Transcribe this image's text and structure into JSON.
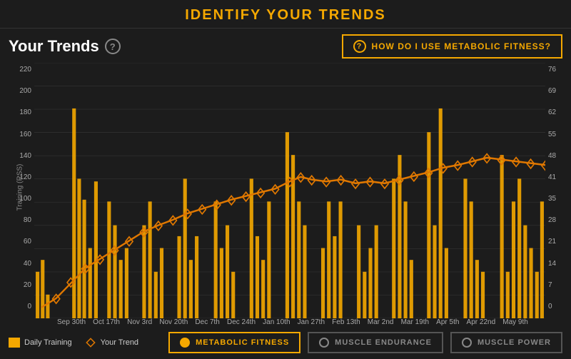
{
  "header": {
    "title": "IDENTIFY YOUR TRENDS"
  },
  "top_bar": {
    "your_trends_label": "Your Trends",
    "help_button_label": "HOW DO I USE METABOLIC FITNESS?"
  },
  "y_axis_left": {
    "label": "Training (RSS)",
    "values": [
      "220",
      "200",
      "180",
      "160",
      "140",
      "120",
      "100",
      "80",
      "60",
      "40",
      "20",
      "0"
    ]
  },
  "y_axis_right": {
    "values": [
      "76",
      "69",
      "62",
      "55",
      "48",
      "41",
      "35",
      "28",
      "21",
      "14",
      "7",
      "0"
    ]
  },
  "x_axis": {
    "labels": [
      "Sep 30th",
      "Oct 17th",
      "Nov 3rd",
      "Nov 20th",
      "Dec 7th",
      "Dec 24th",
      "Jan 10th",
      "Jan 27th",
      "Feb 13th",
      "Mar 2nd",
      "Mar 19th",
      "Apr 5th",
      "Apr 22nd",
      "May 9th"
    ]
  },
  "legend": {
    "daily_training_label": "Daily Training",
    "your_trend_label": "Your Trend"
  },
  "buttons": {
    "metabolic_fitness": "METABOLIC FITNESS",
    "muscle_endurance": "MUSCLE ENDURANCE",
    "muscle_power": "MUSCLE POWER"
  },
  "colors": {
    "gold": "#f5a800",
    "orange_trend": "#e07800",
    "background": "#1c1c1c",
    "grid": "#333333"
  }
}
